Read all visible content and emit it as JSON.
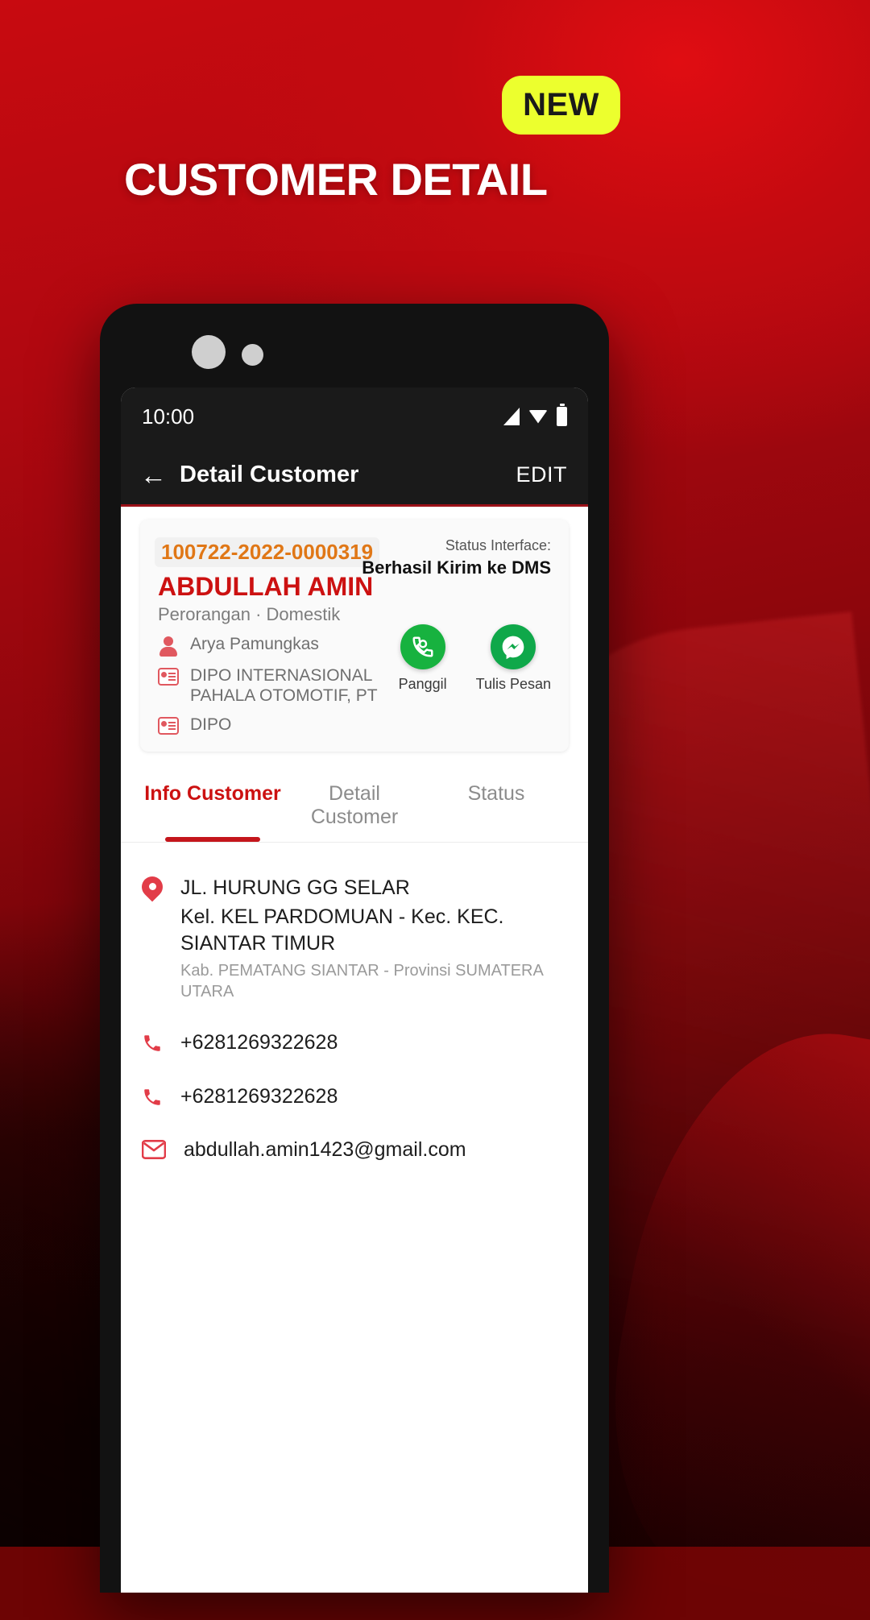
{
  "promo": {
    "badge": "NEW",
    "headline": "CUSTOMER DETAIL",
    "badge_color": "#ecff2e",
    "headline_color": "#ffffff",
    "background_color": "#c40a10"
  },
  "statusbar": {
    "time": "10:00",
    "icons": [
      "signal-icon",
      "wifi-icon",
      "battery-icon"
    ]
  },
  "appbar": {
    "back_icon": "back-arrow-icon",
    "title": "Detail Customer",
    "edit_label": "EDIT"
  },
  "summary": {
    "customer_code": "100722-2022-0000319",
    "customer_name": "ABDULLAH AMIN",
    "customer_type": "Perorangan · Domestik",
    "sales_person": "Arya Pamungkas",
    "company": "DIPO INTERNASIONAL PAHALA OTOMOTIF, PT",
    "branch": "DIPO",
    "status_label": "Status Interface:",
    "status_value": "Berhasil Kirim ke DMS",
    "actions": [
      {
        "label": "Panggil",
        "icon": "phone-call-icon",
        "color": "#17b23f"
      },
      {
        "label": "Tulis Pesan",
        "icon": "messenger-icon",
        "color": "#0fa84a"
      }
    ]
  },
  "tabs": [
    {
      "label": "Info Customer",
      "active": true
    },
    {
      "label": "Detail Customer",
      "active": false
    },
    {
      "label": "Status",
      "active": false
    }
  ],
  "info": {
    "address": {
      "icon": "location-pin-icon",
      "line1": "JL. HURUNG GG SELAR",
      "line2": "Kel. KEL PARDOMUAN - Kec. KEC. SIANTAR  TIMUR",
      "line3": "Kab. PEMATANG SIANTAR - Provinsi SUMATERA UTARA"
    },
    "phone1": {
      "icon": "phone-icon",
      "value": "+6281269322628"
    },
    "phone2": {
      "icon": "phone-icon",
      "value": "+6281269322628"
    },
    "email": {
      "icon": "gmail-icon",
      "value": "abdullah.amin1423@gmail.com"
    }
  }
}
